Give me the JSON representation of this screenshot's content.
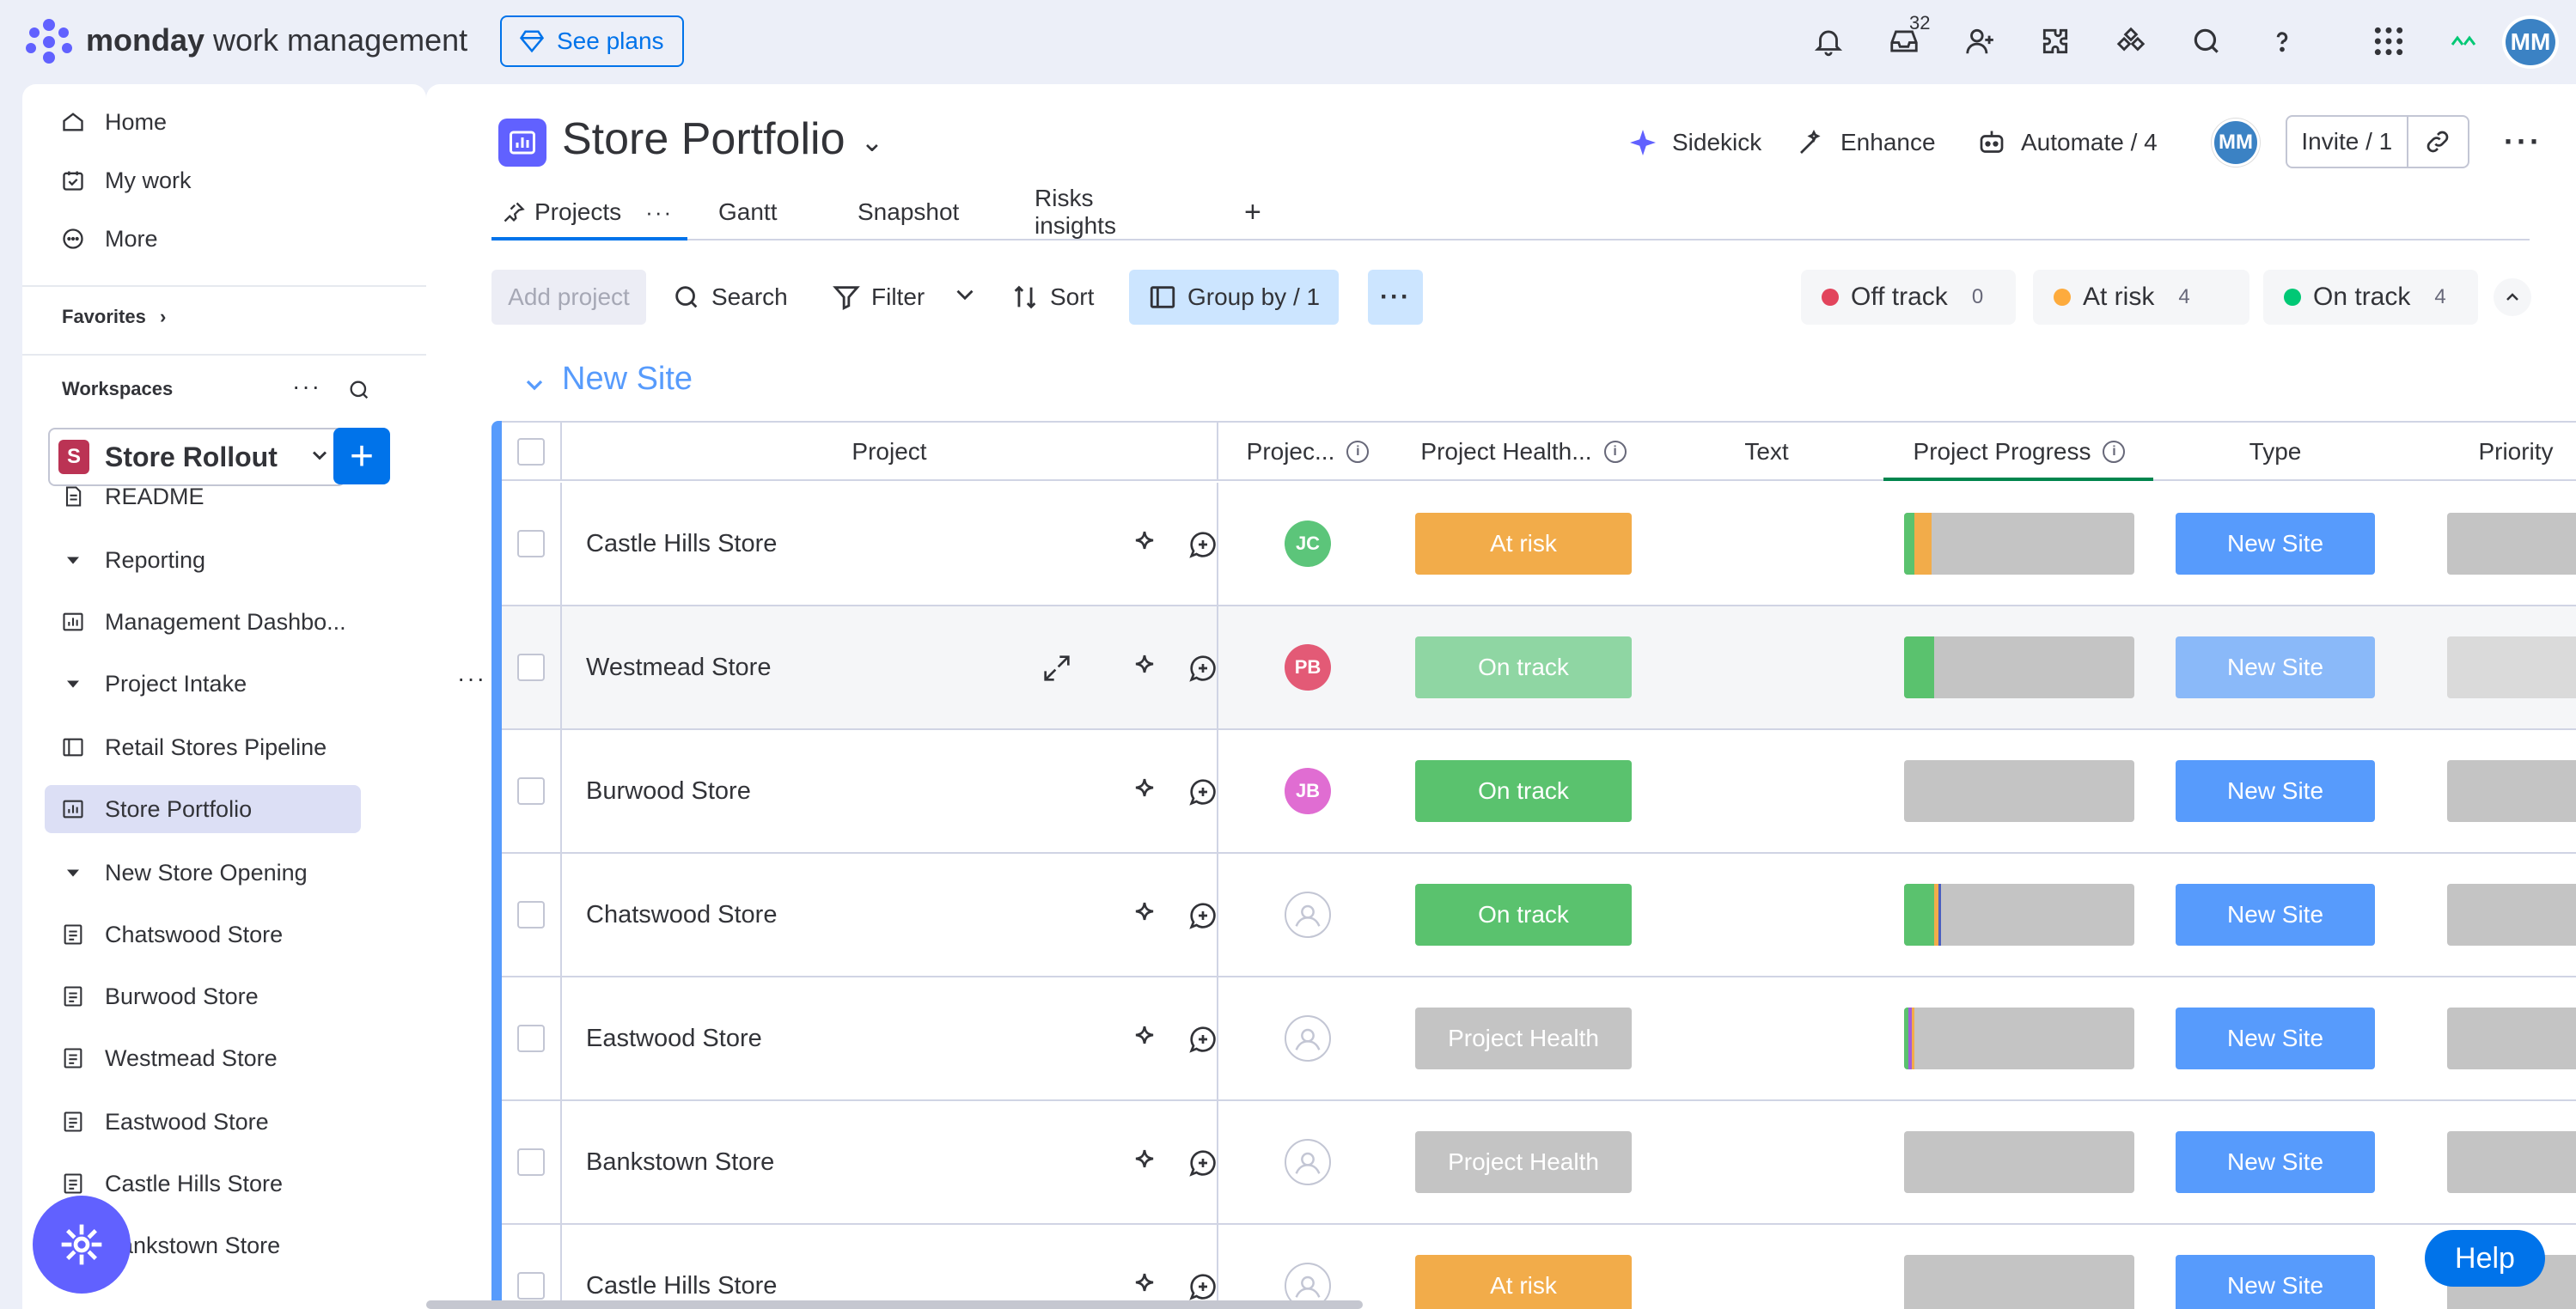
{
  "topbar": {
    "brand_bold": "monday",
    "brand_rest": " work management",
    "see_plans": "See plans",
    "inbox_badge": "32",
    "user_initials": "MM"
  },
  "sidebar": {
    "nav": [
      {
        "label": "Home",
        "icon": "home-icon"
      },
      {
        "label": "My work",
        "icon": "calendar-check-icon"
      },
      {
        "label": "More",
        "icon": "more-circle-icon"
      }
    ],
    "favorites_label": "Favorites",
    "workspaces_label": "Workspaces",
    "workspace_badge": "S",
    "workspace_name": "Store Rollout",
    "tree": [
      {
        "label": "README",
        "level": 0,
        "icon": "doc-icon"
      },
      {
        "label": "Reporting",
        "level": 0,
        "icon": "folder-caret-icon"
      },
      {
        "label": "Management Dashbo...",
        "level": 1,
        "icon": "dashboard-icon"
      },
      {
        "label": "Project Intake",
        "level": 0,
        "icon": "folder-caret-icon"
      },
      {
        "label": "Retail Stores Pipeline",
        "level": 1,
        "icon": "board-icon"
      },
      {
        "label": "Store Portfolio",
        "level": 1,
        "icon": "portfolio-icon",
        "active": true
      },
      {
        "label": "New Store Opening",
        "level": 0,
        "icon": "folder-caret-icon"
      },
      {
        "label": "Chatswood Store",
        "level": 1,
        "icon": "project-icon"
      },
      {
        "label": "Burwood Store",
        "level": 1,
        "icon": "project-icon"
      },
      {
        "label": "Westmead Store",
        "level": 1,
        "icon": "project-icon"
      },
      {
        "label": "Eastwood Store",
        "level": 1,
        "icon": "project-icon"
      },
      {
        "label": "Castle Hills Store",
        "level": 1,
        "icon": "project-icon"
      },
      {
        "label": "Bankstown Store",
        "level": 1,
        "icon": "project-icon"
      }
    ]
  },
  "board": {
    "title": "Store Portfolio",
    "actions": {
      "sidekick": "Sidekick",
      "enhance": "Enhance",
      "automate": "Automate / 4",
      "avatar": "MM",
      "invite": "Invite / 1"
    },
    "tabs": [
      "Projects",
      "Gantt",
      "Snapshot",
      "Risks insights"
    ],
    "toolbar": {
      "add_project": "Add project",
      "search": "Search",
      "filter": "Filter",
      "sort": "Sort",
      "group_by": "Group by / 1"
    },
    "status_summary": [
      {
        "label": "Off track",
        "count": "0",
        "color": "#e2445c"
      },
      {
        "label": "At risk",
        "count": "4",
        "color": "#fdab3d"
      },
      {
        "label": "On track",
        "count": "4",
        "color": "#00c875"
      }
    ],
    "group_title": "New Site",
    "columns": [
      "Project",
      "Projec...",
      "Project Health...",
      "Text",
      "Project Progress",
      "Type",
      "Priority"
    ],
    "rows": [
      {
        "name": "Castle Hills Store",
        "owner": "JC",
        "owner_color": "#5cc57a",
        "health": "At risk",
        "health_color": "#f2ac4a",
        "progress": [
          {
            "c": "#5ac26e",
            "w": 4.5
          },
          {
            "c": "#f2ac4a",
            "w": 7.5
          }
        ],
        "type": "New Site"
      },
      {
        "name": "Westmead Store",
        "owner": "PB",
        "owner_color": "#e35a76",
        "health": "On track",
        "health_color": "#8fd6a3",
        "progress": [
          {
            "c": "#5ac26e",
            "w": 13
          }
        ],
        "type": "New Site",
        "hover": true
      },
      {
        "name": "Burwood Store",
        "owner": "JB",
        "owner_color": "#e06dd2",
        "health": "On track",
        "health_color": "#5ac26e",
        "progress": [],
        "type": "New Site"
      },
      {
        "name": "Chatswood Store",
        "owner": "",
        "owner_color": "",
        "health": "On track",
        "health_color": "#5ac26e",
        "progress": [
          {
            "c": "#5ac26e",
            "w": 13
          },
          {
            "c": "#f2ac4a",
            "w": 2
          },
          {
            "c": "#4a5fc1",
            "w": 1
          }
        ],
        "type": "New Site"
      },
      {
        "name": "Eastwood Store",
        "owner": "",
        "owner_color": "",
        "health": "Project Health",
        "health_color": "#c4c4c4",
        "progress": [
          {
            "c": "#5ac26e",
            "w": 2
          },
          {
            "c": "#a25ddc",
            "w": 1.5
          },
          {
            "c": "#f2ac4a",
            "w": 1
          }
        ],
        "type": "New Site"
      },
      {
        "name": "Bankstown Store",
        "owner": "",
        "owner_color": "",
        "health": "Project Health",
        "health_color": "#c4c4c4",
        "progress": [],
        "type": "New Site"
      },
      {
        "name": "Castle Hills Store",
        "owner": "",
        "owner_color": "",
        "health": "At risk",
        "health_color": "#f2ac4a",
        "progress": [],
        "type": "New Site"
      }
    ]
  },
  "help_label": "Help"
}
